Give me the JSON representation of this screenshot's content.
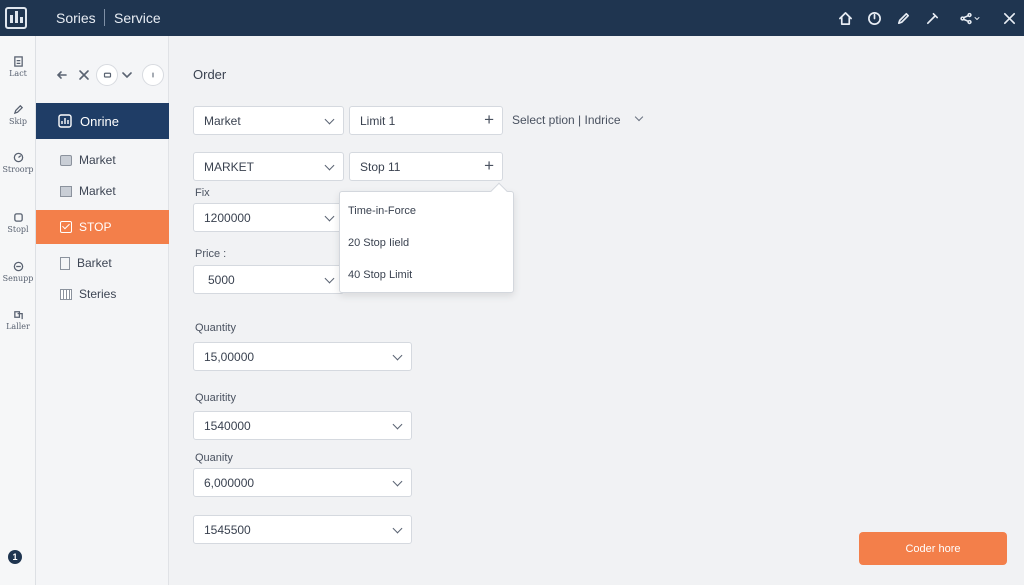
{
  "topbar": {
    "crumb1": "Sories",
    "crumb2": "Service"
  },
  "rail": {
    "items": [
      "Lact",
      "Skip",
      "Stroorp",
      "Stopl",
      "Senupp",
      "Laller"
    ],
    "info": "1"
  },
  "side": {
    "active": "Onrine",
    "items": [
      "Market",
      "Market"
    ],
    "stop": "STOP",
    "items2": [
      "Barket",
      "Steries"
    ]
  },
  "main": {
    "title": "Order",
    "row1": {
      "type": "Market",
      "limit": "Limit 1",
      "select_option": "Select ption | Indrice"
    },
    "row2": {
      "type": "MARKET",
      "stop": "Stop 11"
    },
    "fix": {
      "label": "Fix",
      "value": "1200000"
    },
    "price": {
      "label": "Price :",
      "value": "5000"
    },
    "quantity1": {
      "label": "Quantity",
      "value": "15,00000"
    },
    "quantity2": {
      "label": "Quaritity",
      "value": "1540000"
    },
    "quantity3": {
      "label": "Quanity",
      "value": "6,000000"
    },
    "extra": {
      "value": "1545500"
    }
  },
  "dropdown": {
    "items": [
      "Time-in-Force",
      "20 Stop Iield",
      "40 Stop Limit"
    ]
  },
  "cta": {
    "label": "Coder hore"
  },
  "colors": {
    "topbar": "#1f3550",
    "active_nav": "#1f3d66",
    "accent": "#f37f4a"
  }
}
